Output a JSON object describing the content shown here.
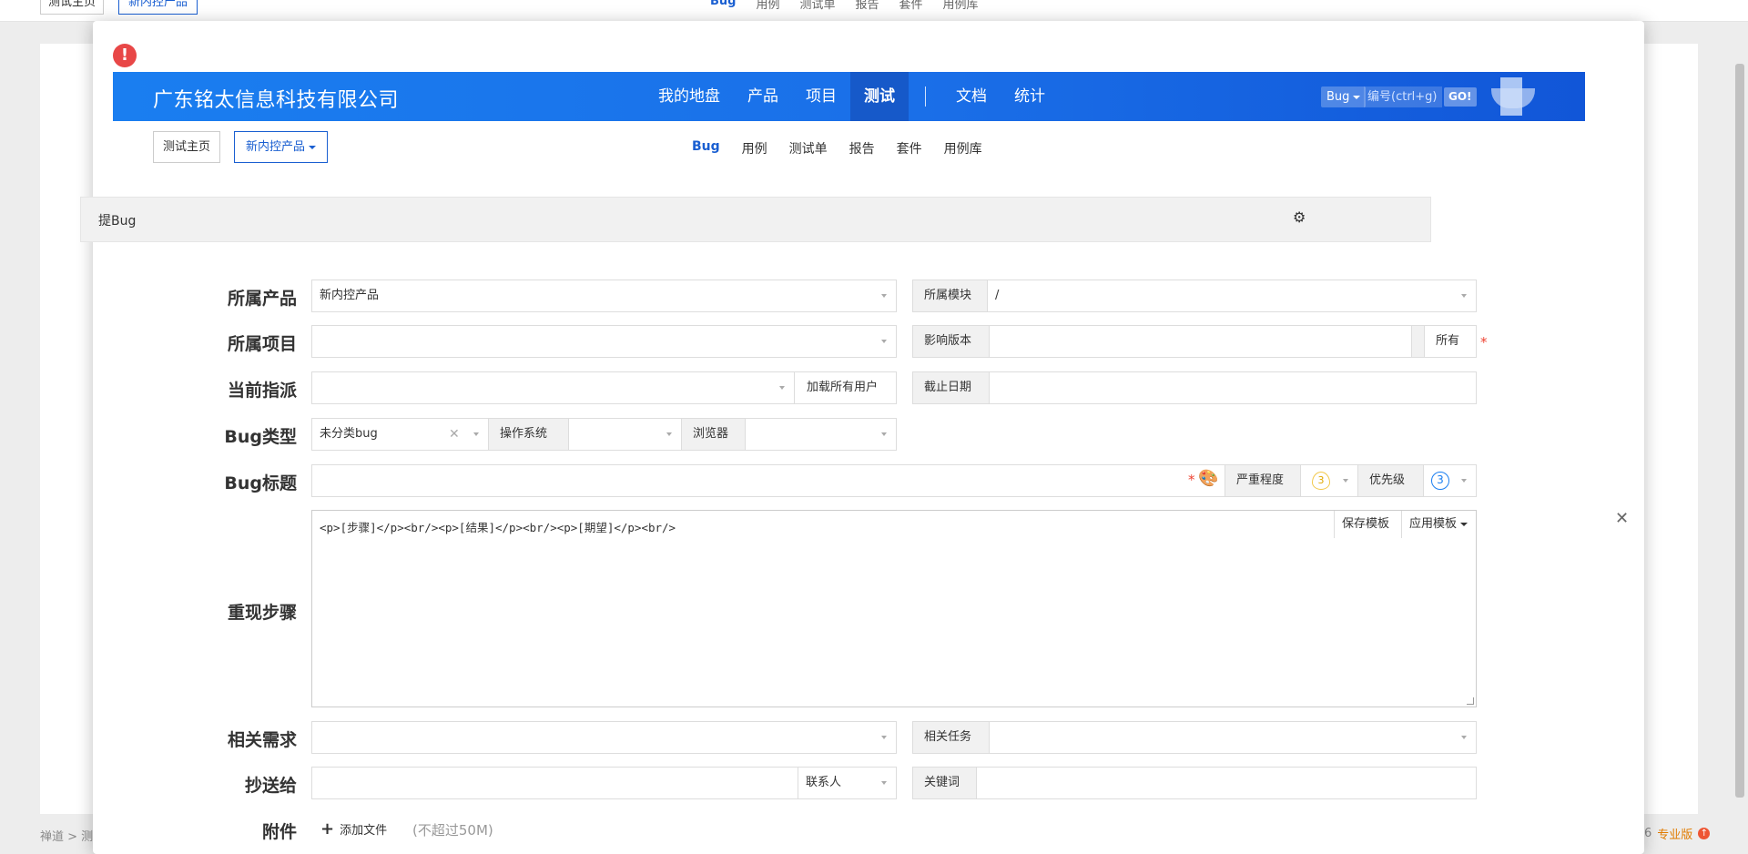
{
  "background": {
    "crumb_home": "测试主页",
    "crumb_product": "新内控产品",
    "menu": [
      "Bug",
      "用例",
      "测试单",
      "报告",
      "套件",
      "用例库"
    ],
    "footer_left": "禅道 > 测",
    "footer_version_tail": "6",
    "footer_edition": "专业版"
  },
  "header": {
    "company": "广东铭太信息科技有限公司",
    "nav": [
      "我的地盘",
      "产品",
      "项目",
      "测试",
      "文档",
      "统计"
    ],
    "active_nav": "测试",
    "search_type": "Bug",
    "search_placeholder": "编号(ctrl+g)",
    "go_label": "GO!"
  },
  "subbar": {
    "crumb_home": "测试主页",
    "crumb_product": "新内控产品",
    "menu": [
      "Bug",
      "用例",
      "测试单",
      "报告",
      "套件",
      "用例库"
    ],
    "active": "Bug"
  },
  "form": {
    "title": "提Bug",
    "product_label": "所属产品",
    "product_value": "新内控产品",
    "module_label": "所属模块",
    "module_value": "/",
    "project_label": "所属项目",
    "version_label": "影响版本",
    "version_all": "所有",
    "assign_label": "当前指派",
    "load_users": "加载所有用户",
    "deadline_label": "截止日期",
    "type_label": "Bug类型",
    "type_value": "未分类bug",
    "os_label": "操作系统",
    "browser_label": "浏览器",
    "bug_title_label": "Bug标题",
    "severity_label": "严重程度",
    "severity_value": "3",
    "priority_label": "优先级",
    "priority_value": "3",
    "steps_label": "重现步骤",
    "steps_value": "<p>[步骤]</p><br/><p>[结果]</p><br/><p>[期望]</p><br/>",
    "save_template": "保存模板",
    "apply_template": "应用模板",
    "story_label": "相关需求",
    "task_label": "相关任务",
    "cc_label": "抄送给",
    "contacts": "联系人",
    "keywords_label": "关键词",
    "attach_label": "附件",
    "add_file": "添加文件",
    "attach_limit": "(不超过50M)"
  }
}
